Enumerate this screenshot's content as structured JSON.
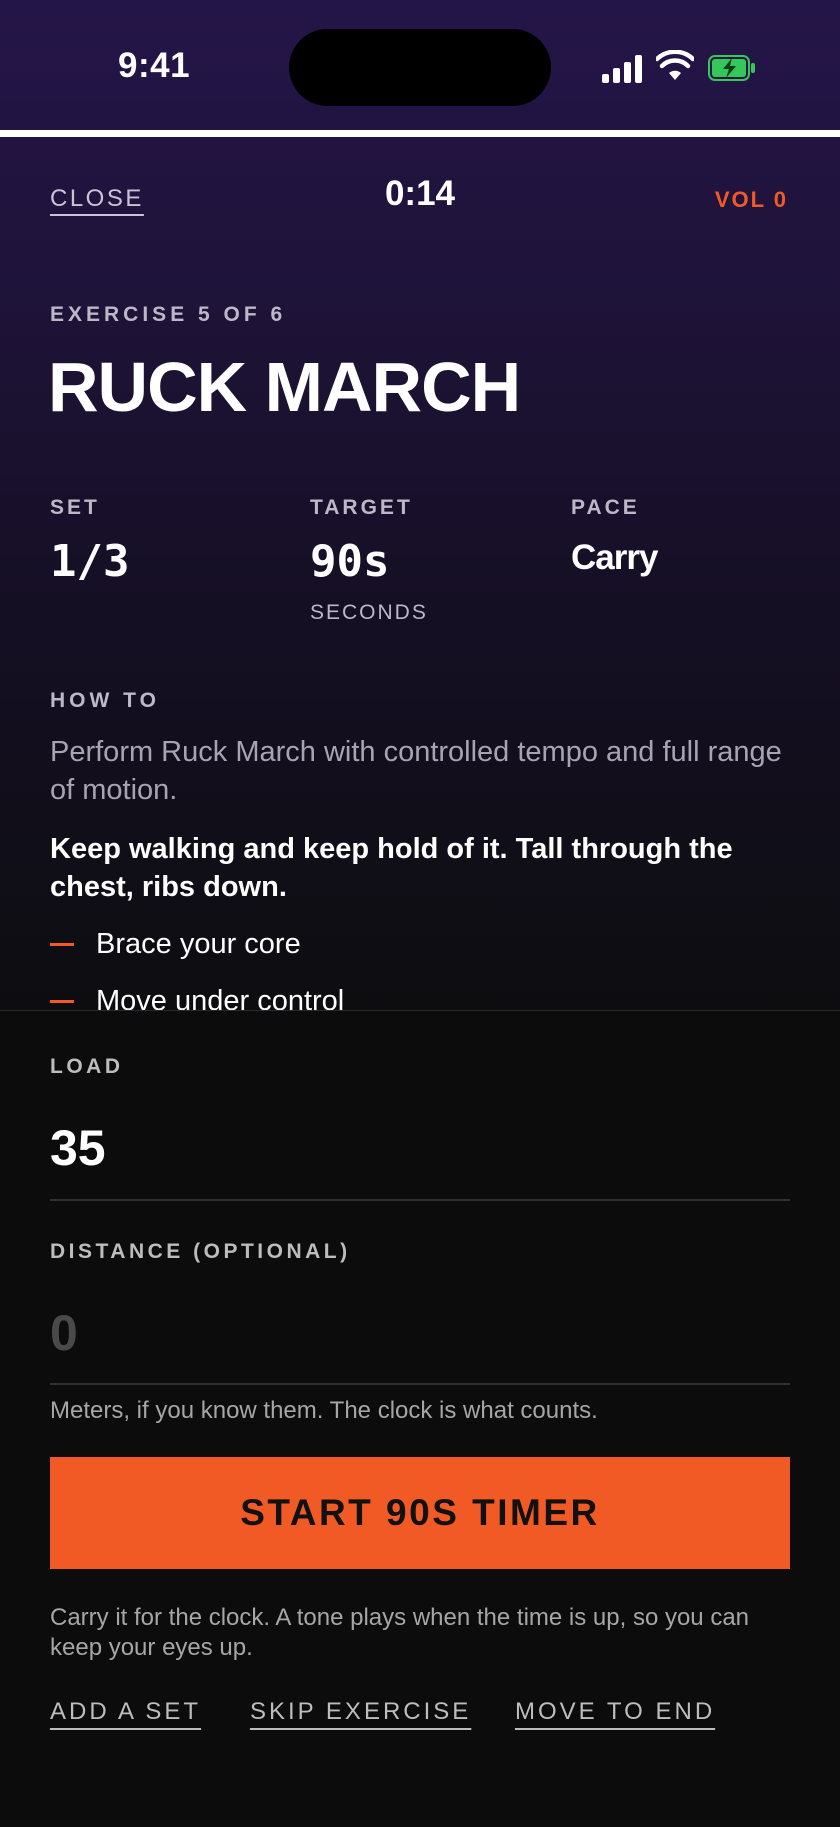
{
  "status_bar": {
    "time": "9:41"
  },
  "workout_progress": 1.0,
  "nav": {
    "close": "CLOSE",
    "elapsed": "0:14",
    "volume": "VOL 0"
  },
  "exercise": {
    "kicker": "EXERCISE 5 OF 6",
    "name": "RUCK MARCH",
    "stats": {
      "set": {
        "label": "SET",
        "value": "1/3"
      },
      "target": {
        "label": "TARGET",
        "value": "90s",
        "unit": "SECONDS"
      },
      "pace": {
        "label": "PACE",
        "value": "Carry"
      }
    },
    "howto": {
      "label": "HOW TO",
      "description": "Perform Ruck March with controlled tempo and full range of motion.",
      "cue": "Keep walking and keep hold of it. Tall through the chest, ribs down.",
      "bullets": [
        "Brace your core",
        "Move under control"
      ]
    }
  },
  "form": {
    "load": {
      "label": "LOAD",
      "value": "35"
    },
    "distance": {
      "label": "DISTANCE (OPTIONAL)",
      "placeholder": "0",
      "hint": "Meters, if you know them. The clock is what counts."
    }
  },
  "cta": {
    "label": "START 90S TIMER",
    "note": "Carry it for the clock. A tone plays when the time is up, so you can keep your eyes up."
  },
  "actions": {
    "add_set": "ADD A SET",
    "skip": "SKIP EXERCISE",
    "move_end": "MOVE TO END"
  },
  "colors": {
    "accent": "#f15a24",
    "bg_top": "#241548",
    "panel": "#0c0c0c",
    "battery": "#34c759"
  }
}
